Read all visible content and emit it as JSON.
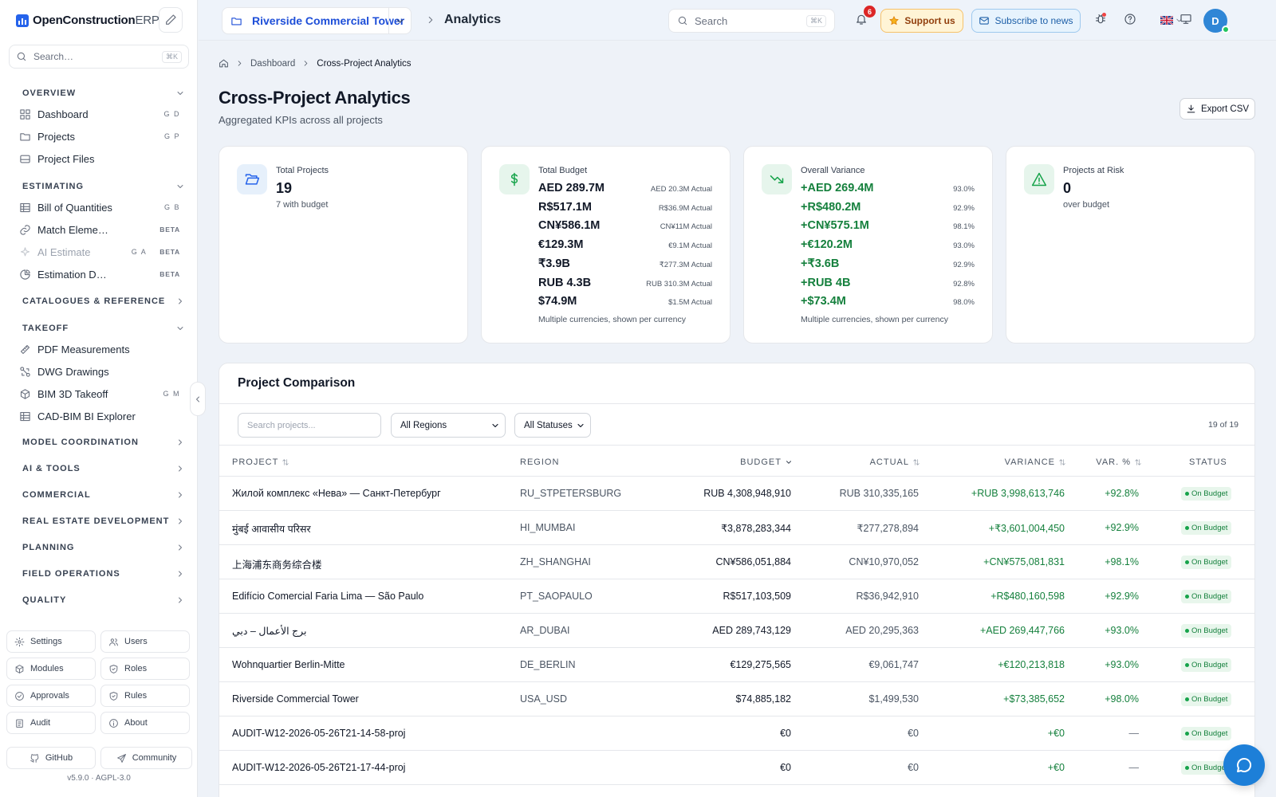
{
  "app": {
    "name_bold": "OpenConstruction",
    "name_rest": "ERP",
    "version": "v5.9.0",
    "license": "AGPL-3.0",
    "version_sep": "·"
  },
  "sidebar": {
    "search_placeholder": "Search…",
    "search_kbd": "⌘K",
    "sections": {
      "overview": "OVERVIEW",
      "estimating": "ESTIMATING",
      "catalogues": "CATALOGUES & REFERENCE",
      "takeoff": "TAKEOFF",
      "model_coordination": "MODEL COORDINATION",
      "ai_tools": "AI & TOOLS",
      "commercial": "COMMERCIAL",
      "real_estate": "REAL ESTATE DEVELOPMENT",
      "planning": "PLANNING",
      "field_operations": "FIELD OPERATIONS",
      "quality": "QUALITY"
    },
    "items": {
      "dashboard": {
        "label": "Dashboard",
        "shortcut": "G D"
      },
      "projects": {
        "label": "Projects",
        "shortcut": "G P"
      },
      "project_files": {
        "label": "Project Files"
      },
      "boq": {
        "label": "Bill of Quantities",
        "shortcut": "G B"
      },
      "match_elements": {
        "label": "Match Eleme…",
        "badge": "BETA"
      },
      "ai_estimate": {
        "label": "AI Estimate",
        "shortcut": "G A",
        "badge": "BETA"
      },
      "estimation_d": {
        "label": "Estimation D…",
        "badge": "BETA"
      },
      "pdf_measurements": {
        "label": "PDF Measurements"
      },
      "dwg_drawings": {
        "label": "DWG Drawings"
      },
      "bim_takeoff": {
        "label": "BIM 3D Takeoff",
        "shortcut": "G M"
      },
      "cad_bim_explorer": {
        "label": "CAD-BIM BI Explorer"
      }
    },
    "bottom": {
      "settings": "Settings",
      "users": "Users",
      "modules": "Modules",
      "roles": "Roles",
      "approvals": "Approvals",
      "rules": "Rules",
      "audit": "Audit",
      "about": "About",
      "github": "GitHub",
      "community": "Community"
    }
  },
  "header": {
    "project": "Riverside Commercial Tower",
    "page": "Analytics",
    "search_placeholder": "Search",
    "search_kbd": "⌘K",
    "notifications_count": "6",
    "support_label": "Support us",
    "subscribe_label": "Subscribe to news",
    "user_initial": "D"
  },
  "breadcrumb": {
    "parent": "Dashboard",
    "current": "Cross-Project Analytics"
  },
  "page": {
    "title": "Cross-Project Analytics",
    "subtitle": "Aggregated KPIs across all projects",
    "export_label": "Export CSV"
  },
  "kpis": {
    "total_projects": {
      "label": "Total Projects",
      "value": "19",
      "note": "7 with budget"
    },
    "total_budget": {
      "label": "Total Budget",
      "rows": [
        {
          "value": "AED 289.7M",
          "actual": "AED 20.3M Actual"
        },
        {
          "value": "R$517.1M",
          "actual": "R$36.9M Actual"
        },
        {
          "value": "CN¥586.1M",
          "actual": "CN¥11M Actual"
        },
        {
          "value": "€129.3M",
          "actual": "€9.1M Actual"
        },
        {
          "value": "₹3.9B",
          "actual": "₹277.3M Actual"
        },
        {
          "value": "RUB 4.3B",
          "actual": "RUB 310.3M Actual"
        },
        {
          "value": "$74.9M",
          "actual": "$1.5M Actual"
        }
      ],
      "footnote": "Multiple currencies, shown per currency"
    },
    "overall_variance": {
      "label": "Overall Variance",
      "rows": [
        {
          "value": "+AED 269.4M",
          "pct": "93.0%"
        },
        {
          "value": "+R$480.2M",
          "pct": "92.9%"
        },
        {
          "value": "+CN¥575.1M",
          "pct": "98.1%"
        },
        {
          "value": "+€120.2M",
          "pct": "93.0%"
        },
        {
          "value": "+₹3.6B",
          "pct": "92.9%"
        },
        {
          "value": "+RUB 4B",
          "pct": "92.8%"
        },
        {
          "value": "+$73.4M",
          "pct": "98.0%"
        }
      ],
      "footnote": "Multiple currencies, shown per currency"
    },
    "projects_at_risk": {
      "label": "Projects at Risk",
      "value": "0",
      "note": "over budget"
    }
  },
  "comparison": {
    "title": "Project Comparison",
    "search_placeholder": "Search projects...",
    "region_filter": "All Regions",
    "status_filter": "All Statuses",
    "count": "19 of 19",
    "columns": {
      "project": "PROJECT",
      "region": "REGION",
      "budget": "BUDGET",
      "actual": "ACTUAL",
      "variance": "VARIANCE",
      "var_pct": "VAR. %",
      "status": "STATUS"
    },
    "rows": [
      {
        "name": "Жилой комплекс «Нева» — Санкт-Петербург",
        "region": "RU_STPETERSBURG",
        "budget": "RUB 4,308,948,910",
        "actual": "RUB 310,335,165",
        "variance": "+RUB 3,998,613,746",
        "var_pct": "+92.8%",
        "status": "On Budget"
      },
      {
        "name": "मुंबई आवासीय परिसर",
        "region": "HI_MUMBAI",
        "budget": "₹3,878,283,344",
        "actual": "₹277,278,894",
        "variance": "+₹3,601,004,450",
        "var_pct": "+92.9%",
        "status": "On Budget"
      },
      {
        "name": "上海浦东商务综合楼",
        "region": "ZH_SHANGHAI",
        "budget": "CN¥586,051,884",
        "actual": "CN¥10,970,052",
        "variance": "+CN¥575,081,831",
        "var_pct": "+98.1%",
        "status": "On Budget"
      },
      {
        "name": "Edifício Comercial Faria Lima — São Paulo",
        "region": "PT_SAOPAULO",
        "budget": "R$517,103,509",
        "actual": "R$36,942,910",
        "variance": "+R$480,160,598",
        "var_pct": "+92.9%",
        "status": "On Budget"
      },
      {
        "name": "برج الأعمال – دبي",
        "region": "AR_DUBAI",
        "budget": "AED 289,743,129",
        "actual": "AED 20,295,363",
        "variance": "+AED 269,447,766",
        "var_pct": "+93.0%",
        "status": "On Budget"
      },
      {
        "name": "Wohnquartier Berlin-Mitte",
        "region": "DE_BERLIN",
        "budget": "€129,275,565",
        "actual": "€9,061,747",
        "variance": "+€120,213,818",
        "var_pct": "+93.0%",
        "status": "On Budget"
      },
      {
        "name": "Riverside Commercial Tower",
        "region": "USA_USD",
        "budget": "$74,885,182",
        "actual": "$1,499,530",
        "variance": "+$73,385,652",
        "var_pct": "+98.0%",
        "status": "On Budget"
      },
      {
        "name": "AUDIT-W12-2026-05-26T21-14-58-proj",
        "region": "",
        "budget": "€0",
        "actual": "€0",
        "variance": "+€0",
        "var_pct": "—",
        "status": "On Budget"
      },
      {
        "name": "AUDIT-W12-2026-05-26T21-17-44-proj",
        "region": "",
        "budget": "€0",
        "actual": "€0",
        "variance": "+€0",
        "var_pct": "—",
        "status": "On Budget"
      }
    ]
  },
  "colors": {
    "accent": "#2563eb",
    "positive": "#15803d",
    "status_bg": "#e8f6ec",
    "chat": "#1d7fd8"
  }
}
